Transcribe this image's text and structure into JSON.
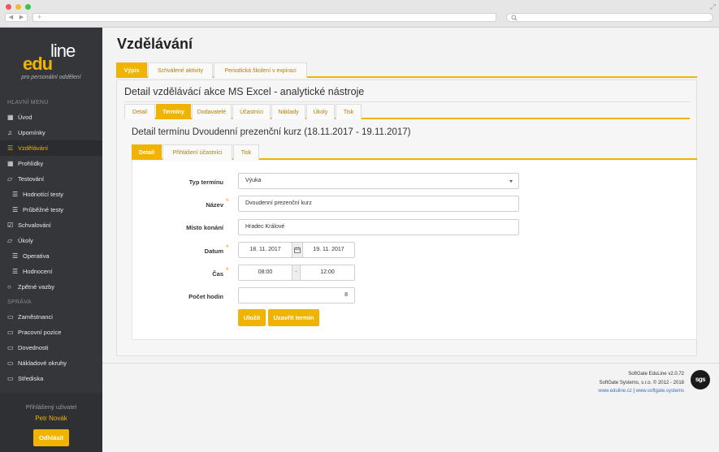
{
  "app": {
    "logo_edu": "edu",
    "logo_line": "line",
    "tagline": "pro personální oddělení"
  },
  "sidebar": {
    "main_heading": "HLAVNÍ MENU",
    "admin_heading": "SPRÁVA",
    "items": [
      {
        "label": "Úvod",
        "icon": "grid-icon"
      },
      {
        "label": "Upomínky",
        "icon": "bell-icon"
      },
      {
        "label": "Vzdělávání",
        "icon": "list-icon",
        "active": true
      },
      {
        "label": "Prohlídky",
        "icon": "grid-icon"
      },
      {
        "label": "Testování",
        "icon": "folder-open-icon"
      },
      {
        "label": "Hodnotící testy",
        "icon": "list-icon",
        "sub": true
      },
      {
        "label": "Průběžné testy",
        "icon": "list-icon",
        "sub": true
      },
      {
        "label": "Schvalování",
        "icon": "check-icon"
      },
      {
        "label": "Úkoly",
        "icon": "folder-open-icon"
      },
      {
        "label": "Operativa",
        "icon": "list-icon",
        "sub": true
      },
      {
        "label": "Hodnocení",
        "icon": "list-icon",
        "sub": true
      },
      {
        "label": "Zpětné vazby",
        "icon": "comment-icon"
      }
    ],
    "admin_items": [
      {
        "label": "Zaměstnanci",
        "icon": "folder-icon"
      },
      {
        "label": "Pracovní pozice",
        "icon": "folder-icon"
      },
      {
        "label": "Dovednosti",
        "icon": "folder-icon"
      },
      {
        "label": "Nákladové okruhy",
        "icon": "folder-icon"
      },
      {
        "label": "Střediska",
        "icon": "folder-icon"
      }
    ],
    "user_label": "Přihlášený uživatel",
    "user_name": "Petr Novák",
    "logout_label": "Odhlásit"
  },
  "page": {
    "title": "Vzdělávání",
    "top_tabs": [
      "Výpis",
      "Schválené aktivity",
      "Periodická školení v expiraci"
    ],
    "detail_title": "Detail vzdělávácí akce MS Excel - analytické nástroje",
    "detail_tabs": [
      "Detail",
      "Termíny",
      "Dodavatelé",
      "Účastníci",
      "Náklady",
      "Úkoly",
      "Tisk"
    ],
    "term_title": "Detail termínu Dvoudenní prezenční kurz (18.11.2017 - 19.11.2017)",
    "term_tabs": [
      "Detail",
      "Přihlášení účastníci",
      "Tisk"
    ]
  },
  "form": {
    "type_label": "Typ termínu",
    "type_value": "Výuka",
    "name_label": "Název",
    "name_value": "Dvoudenní prezenční kurz",
    "place_label": "Místo konání",
    "place_value": "Hradec Králové",
    "date_label": "Datum",
    "date_from": "18. 11. 2017",
    "date_to": "19. 11. 2017",
    "time_label": "Čas",
    "time_from": "08:00",
    "time_sep": "-",
    "time_to": "12:00",
    "hours_label": "Počet hodin",
    "hours_value": "8",
    "required_mark": "*",
    "save_label": "Uložit",
    "close_label": "Uzavřít termín"
  },
  "footer": {
    "line1": "SoftGate EduLine v2.0.72",
    "line2": "SoftGate Systems, s.r.o. © 2012 - 2018",
    "link1": "www.eduline.cz",
    "link_sep": "|",
    "link2": "www.softgate.systems",
    "logo_text": "sgs"
  },
  "colors": {
    "accent": "#f0b400",
    "sidebar": "#34363a"
  }
}
